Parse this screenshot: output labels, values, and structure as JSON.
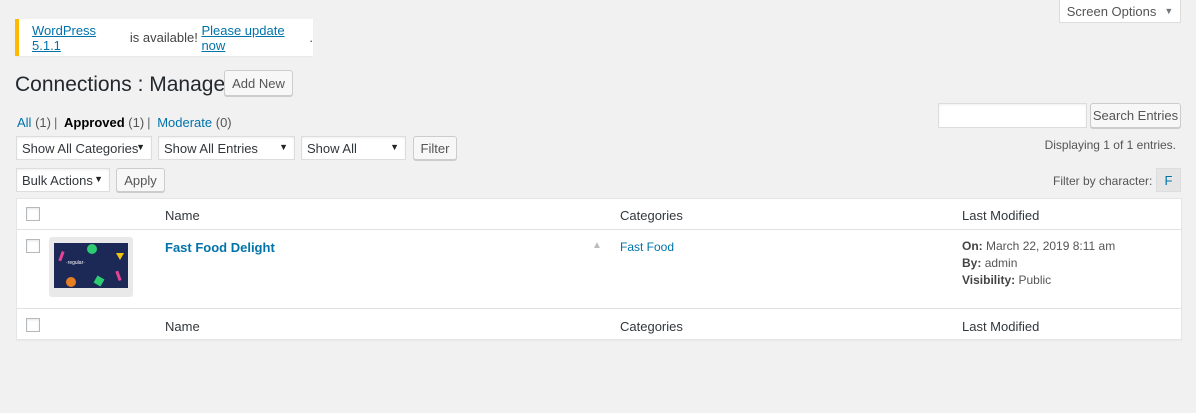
{
  "screen_options": {
    "label": "Screen Options"
  },
  "notice": {
    "link1": "WordPress 5.1.1",
    "text": " is available! ",
    "link2": "Please update now",
    "end": "."
  },
  "page": {
    "title": "Connections : Manage",
    "add_new": "Add New"
  },
  "status_filters": [
    {
      "label": "All",
      "count": "(1)"
    },
    {
      "label": "Approved",
      "count": "(1)"
    },
    {
      "label": "Moderate",
      "count": "(0)"
    }
  ],
  "filters": {
    "categories": "Show All Categories",
    "entries": "Show All Entries",
    "visibility": "Show All",
    "filter_button": "Filter",
    "bulk_actions": "Bulk Actions",
    "apply_button": "Apply"
  },
  "search": {
    "button": "Search Entries",
    "value": ""
  },
  "displaying": "Displaying 1 of 1 entries.",
  "filter_by_character": {
    "label": "Filter by character:",
    "char": "F"
  },
  "table": {
    "headers": {
      "name": "Name",
      "categories": "Categories",
      "last_modified": "Last Modified"
    },
    "rows": [
      {
        "name": "Fast Food Delight",
        "category": "Fast Food",
        "on_label": "On:",
        "on_value": "March 22, 2019 8:11 am",
        "by_label": "By:",
        "by_value": "admin",
        "visibility_label": "Visibility:",
        "visibility_value": "Public",
        "thumb_text": "·regular·"
      }
    ]
  }
}
